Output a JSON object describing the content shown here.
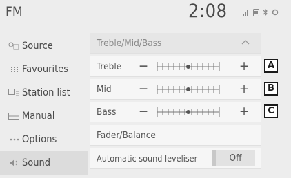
{
  "status": {
    "title": "FM",
    "time": "2:08"
  },
  "sidebar": {
    "items": [
      {
        "label": "Source",
        "icon": "source-icon",
        "active": false
      },
      {
        "label": "Favourites",
        "icon": "favourites-icon",
        "active": false
      },
      {
        "label": "Station list",
        "icon": "station-list-icon",
        "active": false
      },
      {
        "label": "Manual",
        "icon": "manual-icon",
        "active": false
      },
      {
        "label": "Options",
        "icon": "options-icon",
        "active": false
      },
      {
        "label": "Sound",
        "icon": "sound-icon",
        "active": true
      }
    ]
  },
  "main": {
    "section_header": "Treble/Mid/Bass",
    "minus_label": "−",
    "plus_label": "+",
    "tone_rows": [
      {
        "label": "Treble",
        "level": 0,
        "callout": "A"
      },
      {
        "label": "Mid",
        "level": 0,
        "callout": "B"
      },
      {
        "label": "Bass",
        "level": 0,
        "callout": "C"
      }
    ],
    "fader_label": "Fader/Balance",
    "leveliser": {
      "label": "Automatic sound leveliser",
      "value": "Off"
    }
  },
  "colors": {
    "background": "#ededed",
    "row": "#f6f6f6",
    "active_side": "#dcdcdc"
  }
}
